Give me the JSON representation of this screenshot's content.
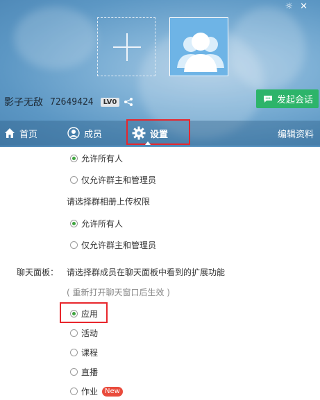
{
  "header": {
    "group_name": "影子无敌",
    "group_id": "72649424",
    "level_badge": "LV0",
    "chat_button": "发起会话"
  },
  "nav": {
    "home": "首页",
    "members": "成员",
    "settings": "设置",
    "edit": "编辑资料"
  },
  "settings": {
    "opt_allow_all_1": "允许所有人",
    "opt_owner_admin_1": "仅允许群主和管理员",
    "album_upload_label": "请选择群相册上传权限",
    "opt_allow_all_2": "允许所有人",
    "opt_owner_admin_2": "仅允许群主和管理员",
    "chat_panel_label": "聊天面板：",
    "chat_panel_desc": "请选择群成员在聊天面板中看到的扩展功能",
    "chat_panel_hint": "( 重新打开聊天窗口后生效 )",
    "opt_app": "应用",
    "opt_activity": "活动",
    "opt_course": "课程",
    "opt_live": "直播",
    "opt_homework": "作业",
    "new_badge": "New"
  },
  "colors": {
    "accent_green": "#2db46a",
    "highlight_red": "#e8262c",
    "radio_selected": "#3fa43f",
    "new_badge": "#e94b3c"
  }
}
